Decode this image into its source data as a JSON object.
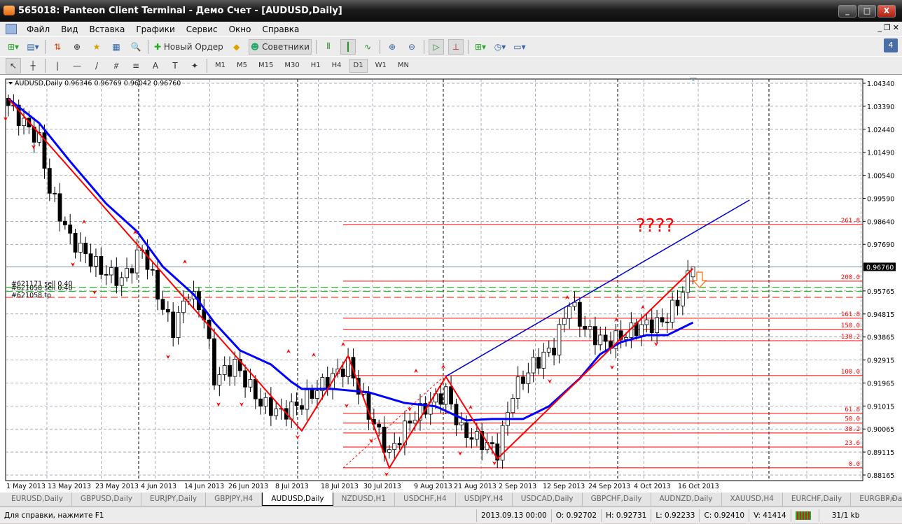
{
  "title": "565018: Panteon Client Terminal - Демо Счет - [AUDUSD,Daily]",
  "window_buttons": {
    "minimize": "_",
    "maximize": "□",
    "close": "X"
  },
  "menu": [
    "Файл",
    "Вид",
    "Вставка",
    "Графики",
    "Сервис",
    "Окно",
    "Справка"
  ],
  "mdi_buttons": [
    "_",
    "❐",
    "✕"
  ],
  "toolbar": {
    "new_order": "Новый Ордер",
    "experts": "Советники",
    "notifications": "4"
  },
  "drawing_tools": [
    "↖",
    "┼",
    "|",
    "—",
    "/",
    "⧣",
    "≡",
    "A",
    "T",
    "✦"
  ],
  "timeframes": [
    "M1",
    "M5",
    "M15",
    "M30",
    "H1",
    "H4",
    "D1",
    "W1",
    "MN"
  ],
  "active_timeframe": "D1",
  "chart": {
    "header": "AUDUSD,Daily  0.96346 0.96769 0.96042 0.96760",
    "annotation": "????",
    "orders": [
      "#621171 sell 0.40",
      "#621058 sell 0.40",
      "#621058 tp"
    ],
    "current_price": "0.96760",
    "price_ticks": [
      "1.04340",
      "1.03390",
      "1.02440",
      "1.01490",
      "1.00540",
      "0.99590",
      "0.98640",
      "0.97690",
      "0.95765",
      "0.94815",
      "0.93865",
      "0.92915",
      "0.91965",
      "0.91015",
      "0.90065",
      "0.89115",
      "0.88165"
    ],
    "date_ticks": [
      "1 May 2013",
      "13 May 2013",
      "23 May 2013",
      "4 Jun 2013",
      "14 Jun 2013",
      "26 Jun 2013",
      "8 Jul 2013",
      "18 Jul 2013",
      "30 Jul 2013",
      "9 Aug 2013",
      "21 Aug 2013",
      "2 Sep 2013",
      "12 Sep 2013",
      "24 Sep 2013",
      "4 Oct 2013",
      "16 Oct 2013"
    ],
    "fibo_levels": [
      {
        "label": "0.0",
        "price": 0.8846
      },
      {
        "label": "23.6",
        "price": 0.8932
      },
      {
        "label": "38.2",
        "price": 0.899
      },
      {
        "label": "50.0",
        "price": 0.9031
      },
      {
        "label": "61.8",
        "price": 0.9071
      },
      {
        "label": "100.0",
        "price": 0.9227
      },
      {
        "label": "138.2",
        "price": 0.9371
      },
      {
        "label": "150.0",
        "price": 0.9418
      },
      {
        "label": "161.8",
        "price": 0.9464
      },
      {
        "label": "200.0",
        "price": 0.9617
      },
      {
        "label": "261.8",
        "price": 0.9851
      }
    ],
    "colors": {
      "bull": "#ffffff",
      "bear": "#000000",
      "ma": "#0000ff",
      "zigzag": "#ff0000",
      "fibo": "#ff0000",
      "trend": "#0000cc",
      "orders": "#00c000",
      "tp": "#ff0000"
    }
  },
  "chart_data": {
    "type": "candlestick",
    "symbol": "AUDUSD",
    "timeframe": "Daily",
    "ylim": [
      0.88165,
      1.0434
    ],
    "close_keypoints": [
      [
        0,
        1.0342
      ],
      [
        6,
        1.0197
      ],
      [
        8,
        0.9995
      ],
      [
        12,
        0.9793
      ],
      [
        18,
        0.9663
      ],
      [
        22,
        0.962
      ],
      [
        26,
        0.975
      ],
      [
        30,
        0.9504
      ],
      [
        32,
        0.9418
      ],
      [
        35,
        0.9576
      ],
      [
        38,
        0.9475
      ],
      [
        40,
        0.9215
      ],
      [
        44,
        0.9273
      ],
      [
        49,
        0.9114
      ],
      [
        53,
        0.9071
      ],
      [
        57,
        0.9114
      ],
      [
        60,
        0.9172
      ],
      [
        66,
        0.9273
      ],
      [
        70,
        0.9071
      ],
      [
        74,
        0.8903
      ],
      [
        78,
        0.9042
      ],
      [
        82,
        0.9114
      ],
      [
        85,
        0.9158
      ],
      [
        88,
        0.8999
      ],
      [
        93,
        0.8941
      ],
      [
        95,
        0.8912
      ],
      [
        98,
        0.9158
      ],
      [
        102,
        0.9273
      ],
      [
        106,
        0.9345
      ],
      [
        109,
        0.9533
      ],
      [
        112,
        0.9418
      ],
      [
        116,
        0.936
      ],
      [
        119,
        0.9389
      ],
      [
        123,
        0.9432
      ],
      [
        127,
        0.9446
      ],
      [
        130,
        0.9533
      ],
      [
        133,
        0.9676
      ]
    ],
    "ma_keypoints": [
      [
        0,
        1.037
      ],
      [
        6,
        1.0269
      ],
      [
        12,
        1.0111
      ],
      [
        19,
        0.9937
      ],
      [
        25,
        0.9822
      ],
      [
        30,
        0.9677
      ],
      [
        36,
        0.9562
      ],
      [
        40,
        0.9446
      ],
      [
        45,
        0.9331
      ],
      [
        51,
        0.9273
      ],
      [
        55,
        0.9201
      ],
      [
        57,
        0.9172
      ],
      [
        63,
        0.9172
      ],
      [
        70,
        0.9158
      ],
      [
        77,
        0.9114
      ],
      [
        83,
        0.91
      ],
      [
        89,
        0.9042
      ],
      [
        94,
        0.9048
      ],
      [
        100,
        0.9048
      ],
      [
        105,
        0.91
      ],
      [
        111,
        0.9215
      ],
      [
        115,
        0.9316
      ],
      [
        119,
        0.9365
      ],
      [
        124,
        0.9394
      ],
      [
        128,
        0.9394
      ],
      [
        133,
        0.9446
      ]
    ],
    "zigzag": [
      [
        0,
        1.037
      ],
      [
        57,
        0.8999
      ],
      [
        66,
        0.9308
      ],
      [
        74,
        0.8846
      ],
      [
        85,
        0.9222
      ],
      [
        95,
        0.8884
      ],
      [
        133,
        0.9669
      ]
    ],
    "trendline": [
      [
        85,
        0.9224
      ],
      [
        144,
        0.9952
      ]
    ],
    "last_bar": {
      "open": 0.96346,
      "high": 0.96769,
      "low": 0.96042,
      "close": 0.9676
    }
  },
  "tabs": [
    "EURUSD,Daily",
    "GBPUSD,Daily",
    "EURJPY,Daily",
    "GBPJPY,H4",
    "AUDUSD,Daily",
    "NZDUSD,H1",
    "USDCHF,H4",
    "USDJPY,H4",
    "USDCAD,Daily",
    "GBPCHF,Daily",
    "AUDNZD,Daily",
    "XAUUSD,H4",
    "EURCHF,Daily",
    "EURGBP,Daily"
  ],
  "active_tab": "AUDUSD,Daily",
  "status": {
    "help": "Для справки, нажмите F1",
    "datetime": "2013.09.13 00:00",
    "open": "O: 0.92702",
    "high": "H: 0.92731",
    "low": "L: 0.92233",
    "close": "C: 0.92410",
    "volume": "V: 41414",
    "traffic": "31/1 kb"
  }
}
